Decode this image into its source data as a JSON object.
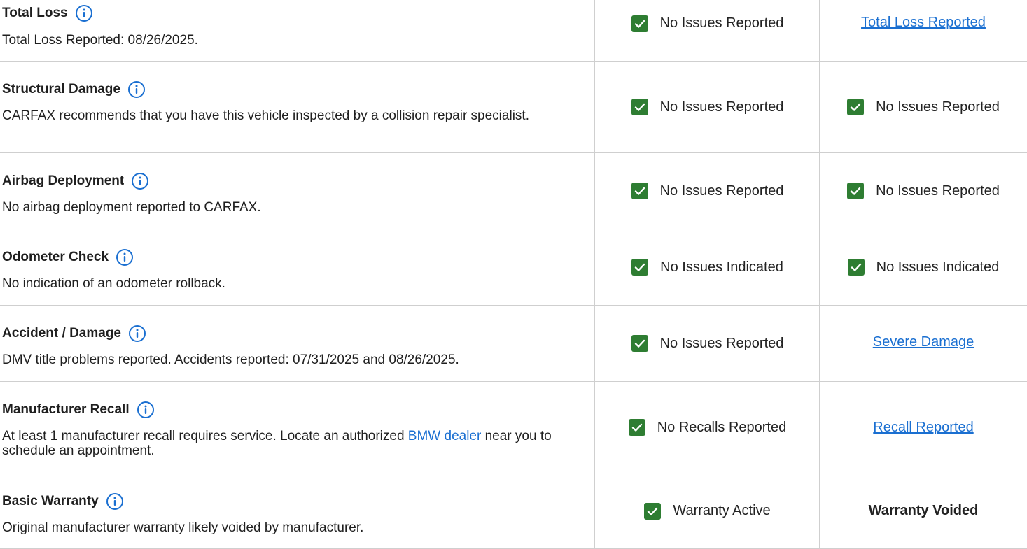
{
  "rows": [
    {
      "title": "Total Loss",
      "description": "Total Loss Reported: 08/26/2025.",
      "carfax_status": "No Issues Reported",
      "other_status": "Total Loss Reported"
    },
    {
      "title": "Structural Damage",
      "description": "CARFAX recommends that you have this vehicle inspected by a collision repair specialist.",
      "carfax_status": "No Issues Reported",
      "other_status": "No Issues Reported"
    },
    {
      "title": "Airbag Deployment",
      "description": "No airbag deployment reported to CARFAX.",
      "carfax_status": "No Issues Reported",
      "other_status": "No Issues Reported"
    },
    {
      "title": "Odometer Check",
      "description": "No indication of an odometer rollback.",
      "carfax_status": "No Issues Indicated",
      "other_status": "No Issues Indicated"
    },
    {
      "title": "Accident / Damage",
      "description": "DMV title problems reported. Accidents reported: 07/31/2025 and 08/26/2025.",
      "carfax_status": "No Issues Reported",
      "other_status": "Severe Damage"
    },
    {
      "title": "Manufacturer Recall",
      "description_before": "At least 1 manufacturer recall requires service. Locate an authorized ",
      "description_link": "BMW dealer",
      "description_after": " near you to schedule an appointment.",
      "carfax_status": "No Recalls Reported",
      "other_status": "Recall Reported"
    },
    {
      "title": "Basic Warranty",
      "description": "Original manufacturer warranty likely voided by manufacturer.",
      "carfax_status": "Warranty Active",
      "other_status": "Warranty Voided"
    }
  ],
  "colors": {
    "check_green": "#2e7d32",
    "link_blue": "#1a6fd1",
    "info_blue": "#1a6fd1",
    "divider": "#cfcfcf"
  },
  "icons": {
    "info": "info-circle-icon",
    "check": "checkbox-checked-icon"
  }
}
